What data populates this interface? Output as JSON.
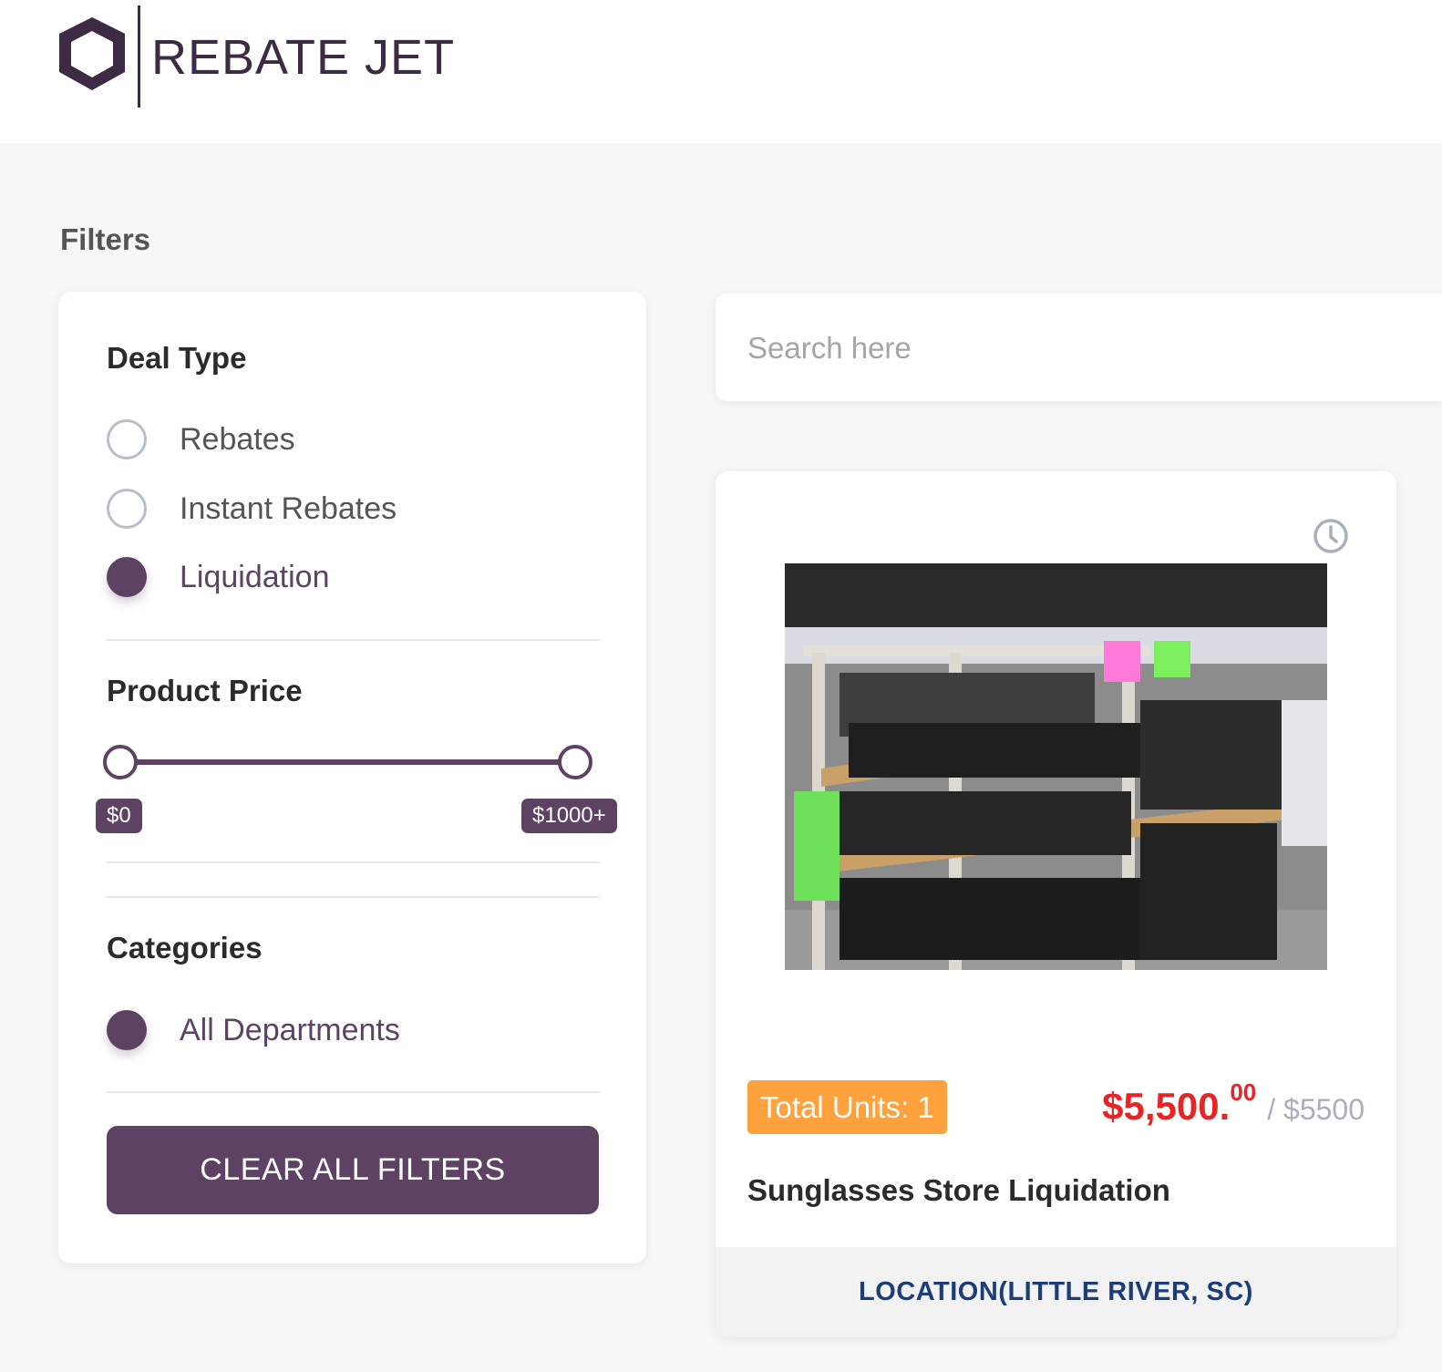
{
  "header": {
    "logo_text": "REBATE JET"
  },
  "filters": {
    "title": "Filters",
    "deal_type": {
      "title": "Deal Type",
      "options": [
        {
          "label": "Rebates",
          "checked": false
        },
        {
          "label": "Instant Rebates",
          "checked": false
        },
        {
          "label": "Liquidation",
          "checked": true
        }
      ]
    },
    "product_price": {
      "title": "Product Price",
      "min_label": "$0",
      "max_label": "$1000+"
    },
    "categories": {
      "title": "Categories",
      "options": [
        {
          "label": "All Departments",
          "checked": true
        }
      ]
    },
    "clear_label": "CLEAR ALL FILTERS"
  },
  "search": {
    "placeholder": "Search here"
  },
  "product": {
    "units": "Total Units: 1",
    "price_whole": "$5,500.",
    "price_cents": "00",
    "price_original": "/ $5500",
    "title": "Sunglasses Store Liquidation",
    "location": "LOCATION(LITTLE RIVER, SC)"
  },
  "colors": {
    "brand": "#5d4264",
    "accent_orange": "#ffa13d",
    "price_red": "#e82525",
    "location_blue": "#1c3d7a"
  }
}
